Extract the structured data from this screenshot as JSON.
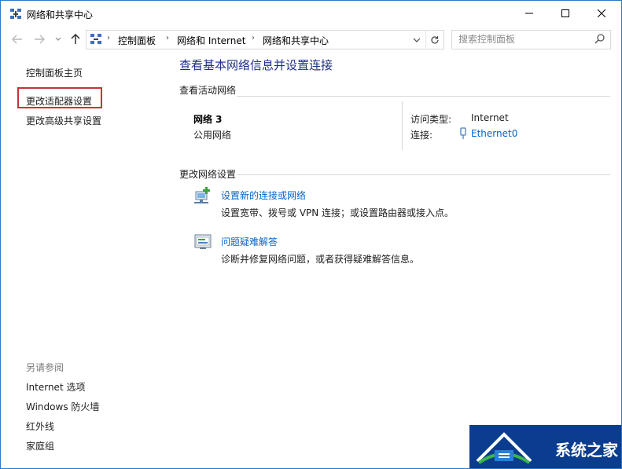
{
  "window": {
    "title": "网络和共享中心"
  },
  "address": {
    "crumbs": [
      "控制面板",
      "网络和 Internet",
      "网络和共享中心"
    ]
  },
  "search": {
    "placeholder": "搜索控制面板"
  },
  "sidebar": {
    "home": "控制面板主页",
    "items": [
      "更改适配器设置",
      "更改高级共享设置"
    ],
    "see_also_title": "另请参阅",
    "see_also": [
      "Internet 选项",
      "Windows 防火墙",
      "红外线",
      "家庭组"
    ]
  },
  "main": {
    "title": "查看基本网络信息并设置连接",
    "active_section": "查看活动网络",
    "network": {
      "name": "网络  3",
      "type": "公用网络",
      "access_label": "访问类型:",
      "access_value": "Internet",
      "connection_label": "连接:",
      "connection_value": "Ethernet0"
    },
    "change_section": "更改网络设置",
    "tasks": [
      {
        "link": "设置新的连接或网络",
        "desc": "设置宽带、拨号或 VPN 连接；或设置路由器或接入点。"
      },
      {
        "link": "问题疑难解答",
        "desc": "诊断并修复网络问题，或者获得疑难解答信息。"
      }
    ]
  },
  "watermark": {
    "text": "系统之家"
  },
  "colors": {
    "link": "#0066cc",
    "title": "#1e3287",
    "highlight": "#c8323a",
    "border": "#2b79c6"
  }
}
